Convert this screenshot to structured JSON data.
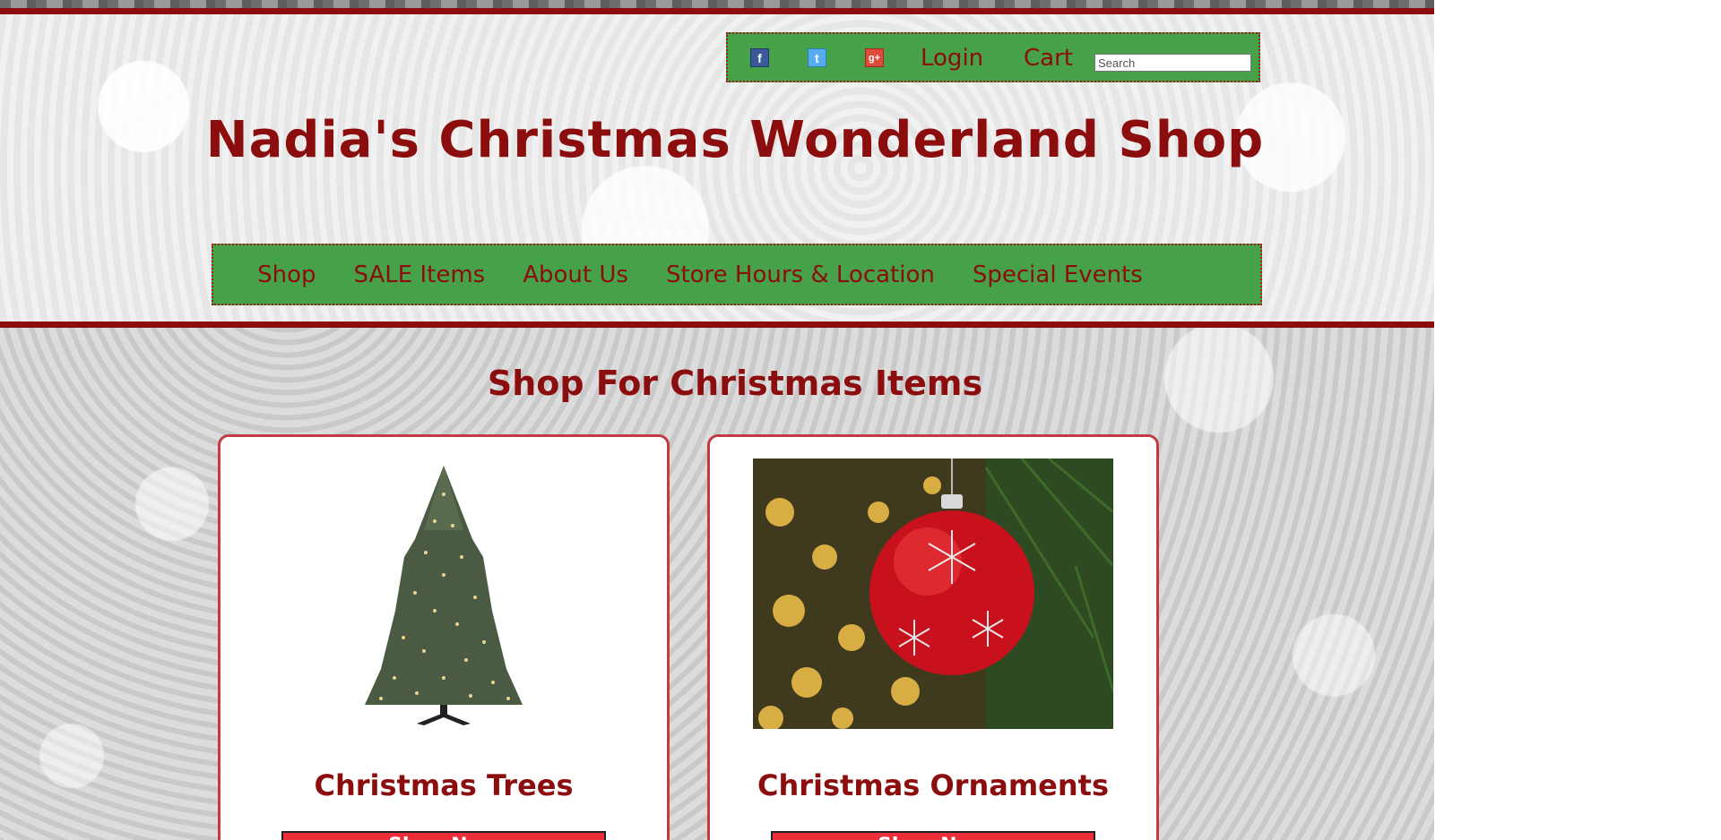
{
  "header": {
    "site_title": "Nadia's Christmas Wonderland Shop",
    "utility": {
      "facebook_glyph": "f",
      "twitter_glyph": "t",
      "googleplus_glyph": "g+",
      "login": "Login",
      "cart": "Cart",
      "search_placeholder": "Search"
    },
    "nav": [
      "Shop",
      "SALE Items",
      "About Us",
      "Store Hours & Location",
      "Special Events"
    ]
  },
  "main": {
    "section_title": "Shop For Christmas Items",
    "cards": [
      {
        "title": "Christmas Trees",
        "button": "Shop Now"
      },
      {
        "title": "Christmas Ornaments",
        "button": "Shop Now"
      }
    ]
  },
  "colors": {
    "brand_red": "#8b0d0d",
    "nav_green": "#46a149",
    "button_red": "#ec2e3a",
    "card_border": "#c23b44"
  },
  "icons": [
    "facebook-icon",
    "twitter-icon",
    "google-plus-icon"
  ]
}
